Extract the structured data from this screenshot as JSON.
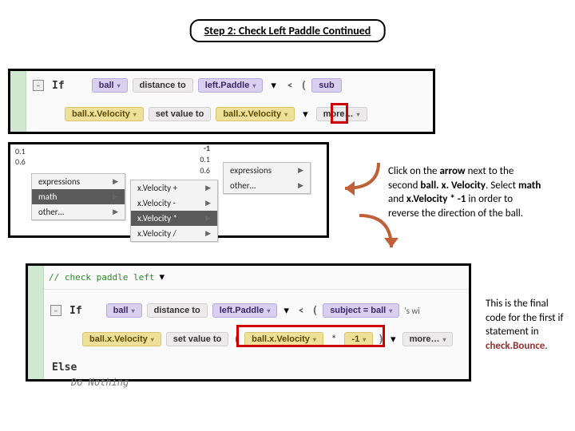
{
  "title": "Step 2: Check Left Paddle Continued",
  "panel1": {
    "if": "If",
    "ball": "ball",
    "distance_to": "distance to",
    "left_paddle": "left.Paddle",
    "lt": "<",
    "sub_trunc": "sub",
    "ball_xvel_a": "ball.x.Velocity",
    "set_value_to": "set value to",
    "ball_xvel_b": "ball.x.Velocity",
    "more": "more…"
  },
  "panel2": {
    "mini_a": "0.1",
    "mini_b": "0.6",
    "col1": [
      "expressions",
      "math",
      "other…"
    ],
    "col2_vals": [
      "-1",
      "0.1",
      "0.6"
    ],
    "col2_items": [
      "x.Velocity +",
      "x.Velocity -",
      "x.Velocity *",
      "x.Velocity /"
    ],
    "col2_sel_index": 2,
    "col3": [
      "expressions",
      "other…"
    ]
  },
  "panel3": {
    "method": "// check paddle left",
    "if": "If",
    "ball": "ball",
    "distance_to": "distance to",
    "left_paddle": "left.Paddle",
    "lt": "<",
    "subject_expr": "subject = ball",
    "s_wi": "'s wi",
    "ball_xvel_a": "ball.x.Velocity",
    "set_value_to": "set value to",
    "open": "(",
    "ball_xvel_b": "ball.x.Velocity",
    "star": "*",
    "neg1": "-1",
    "close": ")",
    "more": "more…",
    "else": "Else",
    "do_nothing": "Do Nothing"
  },
  "anno1_parts": {
    "p1": "Click on the ",
    "b1": "arrow",
    "p2": " next to the second ",
    "b2": "ball. x. Velocity",
    "p3": ". Select ",
    "b3": "math",
    "p4": " and ",
    "b4": "x.Velocity * -1",
    "p5": " in order to reverse the direction of the ball."
  },
  "anno2_parts": {
    "p1": "This is the final code for the first if statement in ",
    "kw": "check.Bounce",
    "p2": "."
  }
}
